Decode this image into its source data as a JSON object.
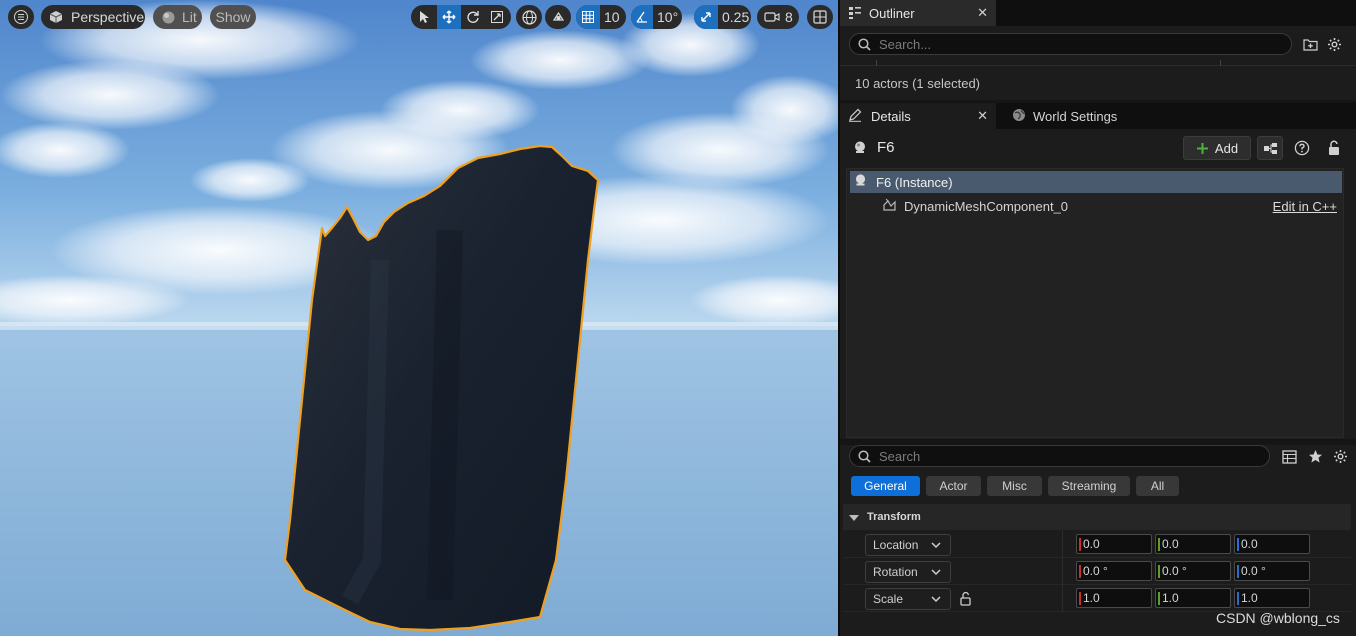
{
  "viewport": {
    "menu_icon": "hamburger-icon",
    "view_mode": "Perspective",
    "lit_label": "Lit",
    "show_label": "Show",
    "grid_snap": "10",
    "rotation_snap": "10°",
    "scale_snap": "0.25",
    "camera_speed": "8",
    "colors": {
      "selection_outline": "#f0a020",
      "sky": "#5d8fd0",
      "ground": "#8fb5d8",
      "mesh": "#1c2432"
    }
  },
  "outliner": {
    "tab_label": "Outliner",
    "search_placeholder": "Search...",
    "status": "10 actors (1 selected)"
  },
  "details": {
    "tab_label": "Details",
    "world_tab_label": "World Settings",
    "actor_name": "F6",
    "add_label": "Add",
    "component_root": "F6 (Instance)",
    "component_child": "DynamicMeshComponent_0",
    "edit_link": "Edit in C++",
    "search_placeholder": "Search",
    "filters": [
      "General",
      "Actor",
      "Misc",
      "Streaming",
      "All"
    ],
    "active_filter": "General",
    "section_title": "Transform",
    "rows": [
      {
        "label": "Location",
        "x": "0.0",
        "y": "0.0",
        "z": "0.0"
      },
      {
        "label": "Rotation",
        "x": "0.0 °",
        "y": "0.0 °",
        "z": "0.0 °"
      },
      {
        "label": "Scale",
        "x": "1.0",
        "y": "1.0",
        "z": "1.0"
      }
    ],
    "axis_colors": [
      "#c8302a",
      "#5aa02a",
      "#2a6ec8"
    ]
  },
  "watermark": "CSDN @wblong_cs"
}
